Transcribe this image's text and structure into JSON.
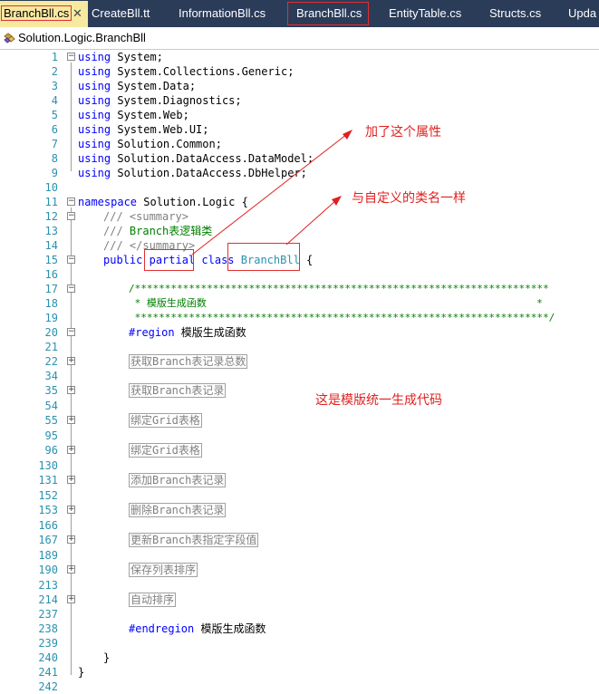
{
  "tabs": [
    {
      "label": "BranchBll.cs",
      "active": true
    },
    {
      "label": "CreateBll.tt"
    },
    {
      "label": "InformationBll.cs"
    },
    {
      "label": "BranchBll.cs"
    },
    {
      "label": "EntityTable.cs"
    },
    {
      "label": "Structs.cs"
    },
    {
      "label": "Upda"
    }
  ],
  "close_glyph": "✕",
  "breadcrumb": "Solution.Logic.BranchBll",
  "line_numbers": [
    "1",
    "2",
    "3",
    "4",
    "5",
    "6",
    "7",
    "8",
    "9",
    "10",
    "11",
    "12",
    "13",
    "14",
    "15",
    "16",
    "17",
    "18",
    "19",
    "20",
    "21",
    "22",
    "34",
    "35",
    "54",
    "55",
    "95",
    "96",
    "130",
    "131",
    "152",
    "153",
    "166",
    "167",
    "189",
    "190",
    "213",
    "214",
    "237",
    "238",
    "239",
    "240",
    "241",
    "242"
  ],
  "code": {
    "kw_using": "using",
    "ns1": " System;",
    "ns2": " System.Collections.Generic;",
    "ns3": " System.Data;",
    "ns4": " System.Diagnostics;",
    "ns5": " System.Web;",
    "ns6": " System.Web.UI;",
    "ns7": " Solution.Common;",
    "ns8": " Solution.DataAccess.DataModel;",
    "ns9": " Solution.DataAccess.DbHelper;",
    "kw_namespace": "namespace",
    "namespace_name": " Solution.Logic {",
    "doc_prefix": "///",
    "doc_summary_open": " <summary>",
    "doc_text": " Branch表逻辑类",
    "doc_summary_close": " </summary>",
    "kw_public": "public",
    "kw_partial": "partial",
    "kw_class": "class",
    "class_name": "BranchBll",
    "brace_open": " {",
    "comment_line1": "/*********************************************************************",
    "comment_line2": " * 模版生成函数                                                       *",
    "comment_line3": " *********************************************************************/",
    "kw_region": "#region",
    "region_name": " 模版生成函数",
    "collapsed": [
      "获取Branch表记录总数",
      "获取Branch表记录",
      "绑定Grid表格",
      "绑定Grid表格",
      "添加Branch表记录",
      "删除Branch表记录",
      "更新Branch表指定字段值",
      "保存列表排序",
      "自动排序"
    ],
    "kw_endregion": "#endregion",
    "endregion_name": " 模版生成函数",
    "brace_close_class": "}",
    "brace_close_ns": "}"
  },
  "annotations": {
    "added_attribute": "加了这个属性",
    "same_as_class": "与自定义的类名一样",
    "template_generated": "这是模版统一生成代码"
  },
  "colors": {
    "tabbar_bg": "#2b3c59",
    "active_tab_bg": "#f7e9a0",
    "keyword": "#0000ff",
    "comment": "#008000",
    "type": "#2b91af",
    "annotation": "#e02020"
  }
}
